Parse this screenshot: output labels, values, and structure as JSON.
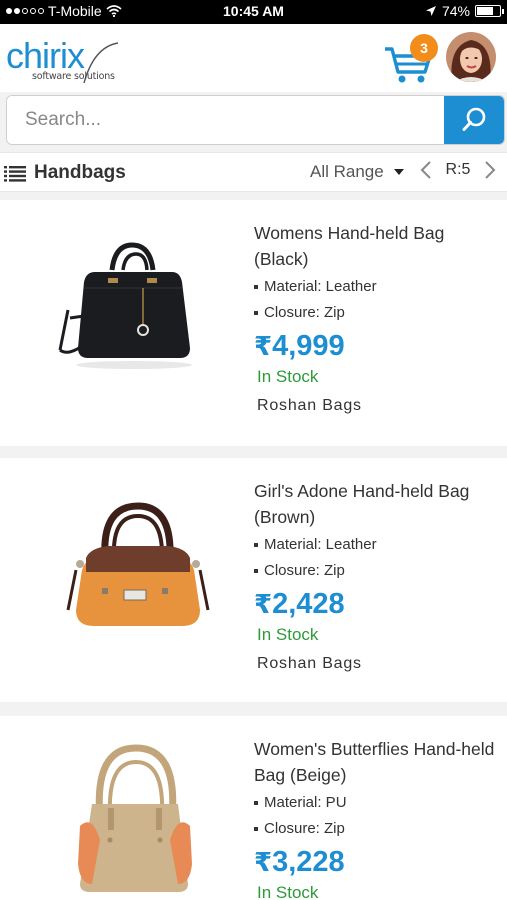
{
  "status_bar": {
    "carrier": "T-Mobile",
    "time": "10:45 AM",
    "battery_percent": "74%",
    "battery_level": 0.74,
    "signal_bars_filled": 2,
    "signal_bars_total": 5,
    "icons": [
      "wifi-icon",
      "location-arrow-icon",
      "battery-icon"
    ]
  },
  "header": {
    "logo_word": "chirix",
    "logo_tagline": "software solutions",
    "cart_count": "3",
    "cart_icon": "cart-icon",
    "avatar_icon": "user-avatar"
  },
  "search": {
    "placeholder": "Search...",
    "value": "",
    "icon": "search-icon"
  },
  "filter_bar": {
    "category_icon": "list-icon",
    "category": "Handbags",
    "range": "All Range",
    "page_label": "R:5"
  },
  "colors": {
    "accent": "#1d8ed1",
    "badge": "#f28c1b",
    "in_stock": "#2e9a3a"
  },
  "products": [
    {
      "title": "Womens Hand-held Bag (Black)",
      "specs": [
        "Material: Leather",
        "Closure: Zip"
      ],
      "currency": "₹",
      "price": "4,999",
      "stock": "In Stock",
      "seller": "Roshan Bags",
      "color": "#1b1c20"
    },
    {
      "title": "Girl's Adone Hand-held Bag (Brown)",
      "specs": [
        "Material: Leather",
        "Closure: Zip"
      ],
      "currency": "₹",
      "price": "2,428",
      "stock": "In Stock",
      "seller": "Roshan Bags",
      "color": "#e7923c"
    },
    {
      "title": "Women's Butterflies Hand-held Bag (Beige)",
      "specs": [
        "Material: PU",
        "Closure: Zip"
      ],
      "currency": "₹",
      "price": "3,228",
      "stock": "In Stock",
      "seller": "",
      "color": "#cdb48c"
    }
  ]
}
